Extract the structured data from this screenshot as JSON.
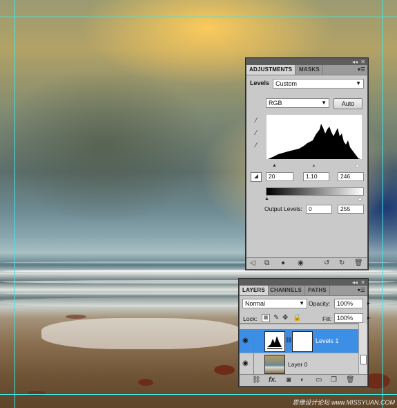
{
  "adjustments": {
    "tabs": [
      "ADJUSTMENTS",
      "MASKS"
    ],
    "levels_label": "Levels",
    "preset": "Custom",
    "channel": "RGB",
    "auto_label": "Auto",
    "input_black": "20",
    "input_gamma": "1.10",
    "input_white": "246",
    "output_label": "Output Levels:",
    "output_black": "0",
    "output_white": "255"
  },
  "layers": {
    "tabs": [
      "LAYERS",
      "CHANNELS",
      "PATHS"
    ],
    "blend_mode": "Normal",
    "opacity_label": "Opacity:",
    "opacity": "100%",
    "lock_label": "Lock:",
    "fill_label": "Fill:",
    "fill": "100%",
    "items": [
      {
        "name": "Levels 1",
        "selected": true
      },
      {
        "name": "Layer 0",
        "selected": false
      }
    ]
  },
  "watermark": "思缘设计论坛 www.MISSYUAN.COM",
  "colors": {
    "guide": "#3fe6e6",
    "selection": "#3d8fe6",
    "panel": "#c9c9c9"
  }
}
